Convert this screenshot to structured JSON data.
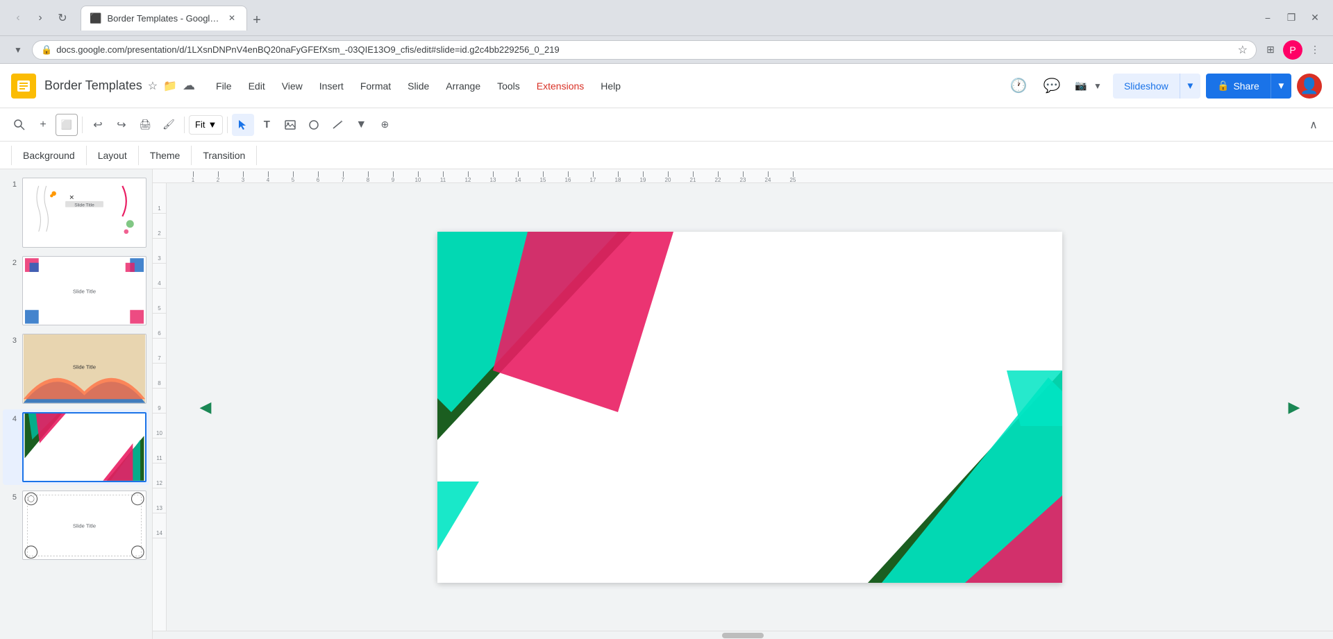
{
  "browser": {
    "tab_title": "Border Templates - Google Slid...",
    "tab_favicon": "📊",
    "address": "docs.google.com/presentation/d/1LXsnDNPnV4enBQ20naFyGFEfXsm_-03QIE13O9_cfis/edit#slide=id.g2c4bb229256_0_219",
    "new_tab_label": "+",
    "back_btn": "‹",
    "forward_btn": "›",
    "reload_btn": "↻",
    "minimize": "−",
    "maximize": "❐",
    "close": "✕",
    "profile_initial": "P"
  },
  "app": {
    "logo_color": "#fbbc04",
    "title": "Border Templates",
    "star_label": "☆",
    "folder_label": "📁",
    "cloud_label": "☁",
    "menus": [
      "File",
      "Edit",
      "View",
      "Insert",
      "Format",
      "Slide",
      "Arrange",
      "Tools",
      "Extensions",
      "Help"
    ],
    "slideshow_label": "Slideshow",
    "share_label": "Share",
    "share_icon": "🔒"
  },
  "toolbar": {
    "undo": "↩",
    "redo": "↪",
    "print": "🖨",
    "paint_format": "🎨",
    "zoom_value": "Fit",
    "search_icon": "🔍",
    "add_icon": "+",
    "text_box_icon": "⊡",
    "cursor_icon": "↖",
    "text_icon": "T",
    "image_icon": "🖼",
    "shapes_icon": "⬠",
    "line_icon": "/",
    "accessibility_icon": "♿",
    "background_label": "Background",
    "layout_label": "Layout",
    "theme_label": "Theme",
    "transition_label": "Transition",
    "collapse_icon": "∧"
  },
  "slides": [
    {
      "number": "1",
      "type": "decorative_lines",
      "title": "Slide Title",
      "active": false
    },
    {
      "number": "2",
      "type": "colorful_squares",
      "title": "Slide Title",
      "active": false
    },
    {
      "number": "3",
      "type": "gradient_arc",
      "title": "Slide Title",
      "active": false
    },
    {
      "number": "4",
      "type": "diagonal_stripes",
      "title": "",
      "active": true
    },
    {
      "number": "5",
      "type": "ornamental",
      "title": "Slide Title",
      "active": false
    }
  ],
  "canvas": {
    "nav_left": "◀",
    "nav_right": "▶",
    "ruler_numbers": [
      "1",
      "2",
      "3",
      "4",
      "5",
      "6",
      "7",
      "8",
      "9",
      "10",
      "11",
      "12",
      "13",
      "14",
      "15",
      "16",
      "17",
      "18",
      "19",
      "20",
      "21",
      "22",
      "23",
      "24",
      "25"
    ]
  },
  "colors": {
    "green": "#1a6b3a",
    "red": "#e91e63",
    "cyan": "#00e5c3",
    "dark_green": "#1b5e20",
    "accent_blue": "#1a73e8"
  }
}
